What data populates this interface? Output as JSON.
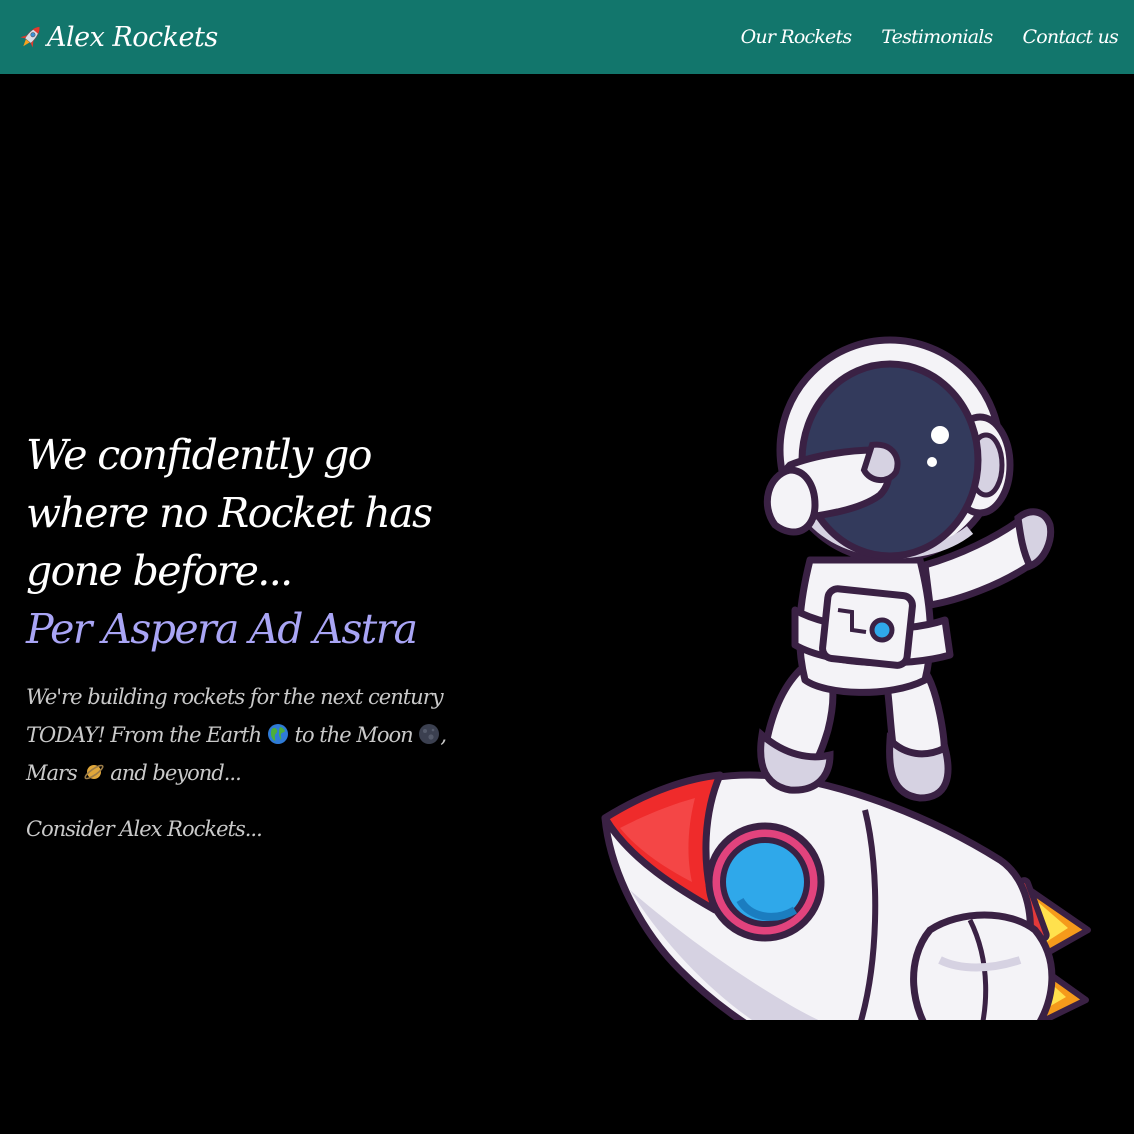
{
  "nav": {
    "brand": "Alex Rockets",
    "links": [
      {
        "label": "Our Rockets"
      },
      {
        "label": "Testimonials"
      },
      {
        "label": "Contact us"
      }
    ]
  },
  "hero": {
    "heading": "We confidently go where no Rocket has gone before...",
    "motto": "Per Aspera Ad Astra",
    "para_part1": "We're building rockets for the next century TODAY! From the Earth",
    "para_part2": "to the Moon",
    "para_part3": ", Mars",
    "para_part4": "and beyond...",
    "para2": "Consider Alex Rockets...",
    "illustration_icon": "astronaut-on-rocket-illustration"
  },
  "colors": {
    "navbar": "#12766c",
    "background": "#000000",
    "heading": "#ffffff",
    "motto": "#a9a5f5",
    "body_text": "#c9c9c9"
  }
}
